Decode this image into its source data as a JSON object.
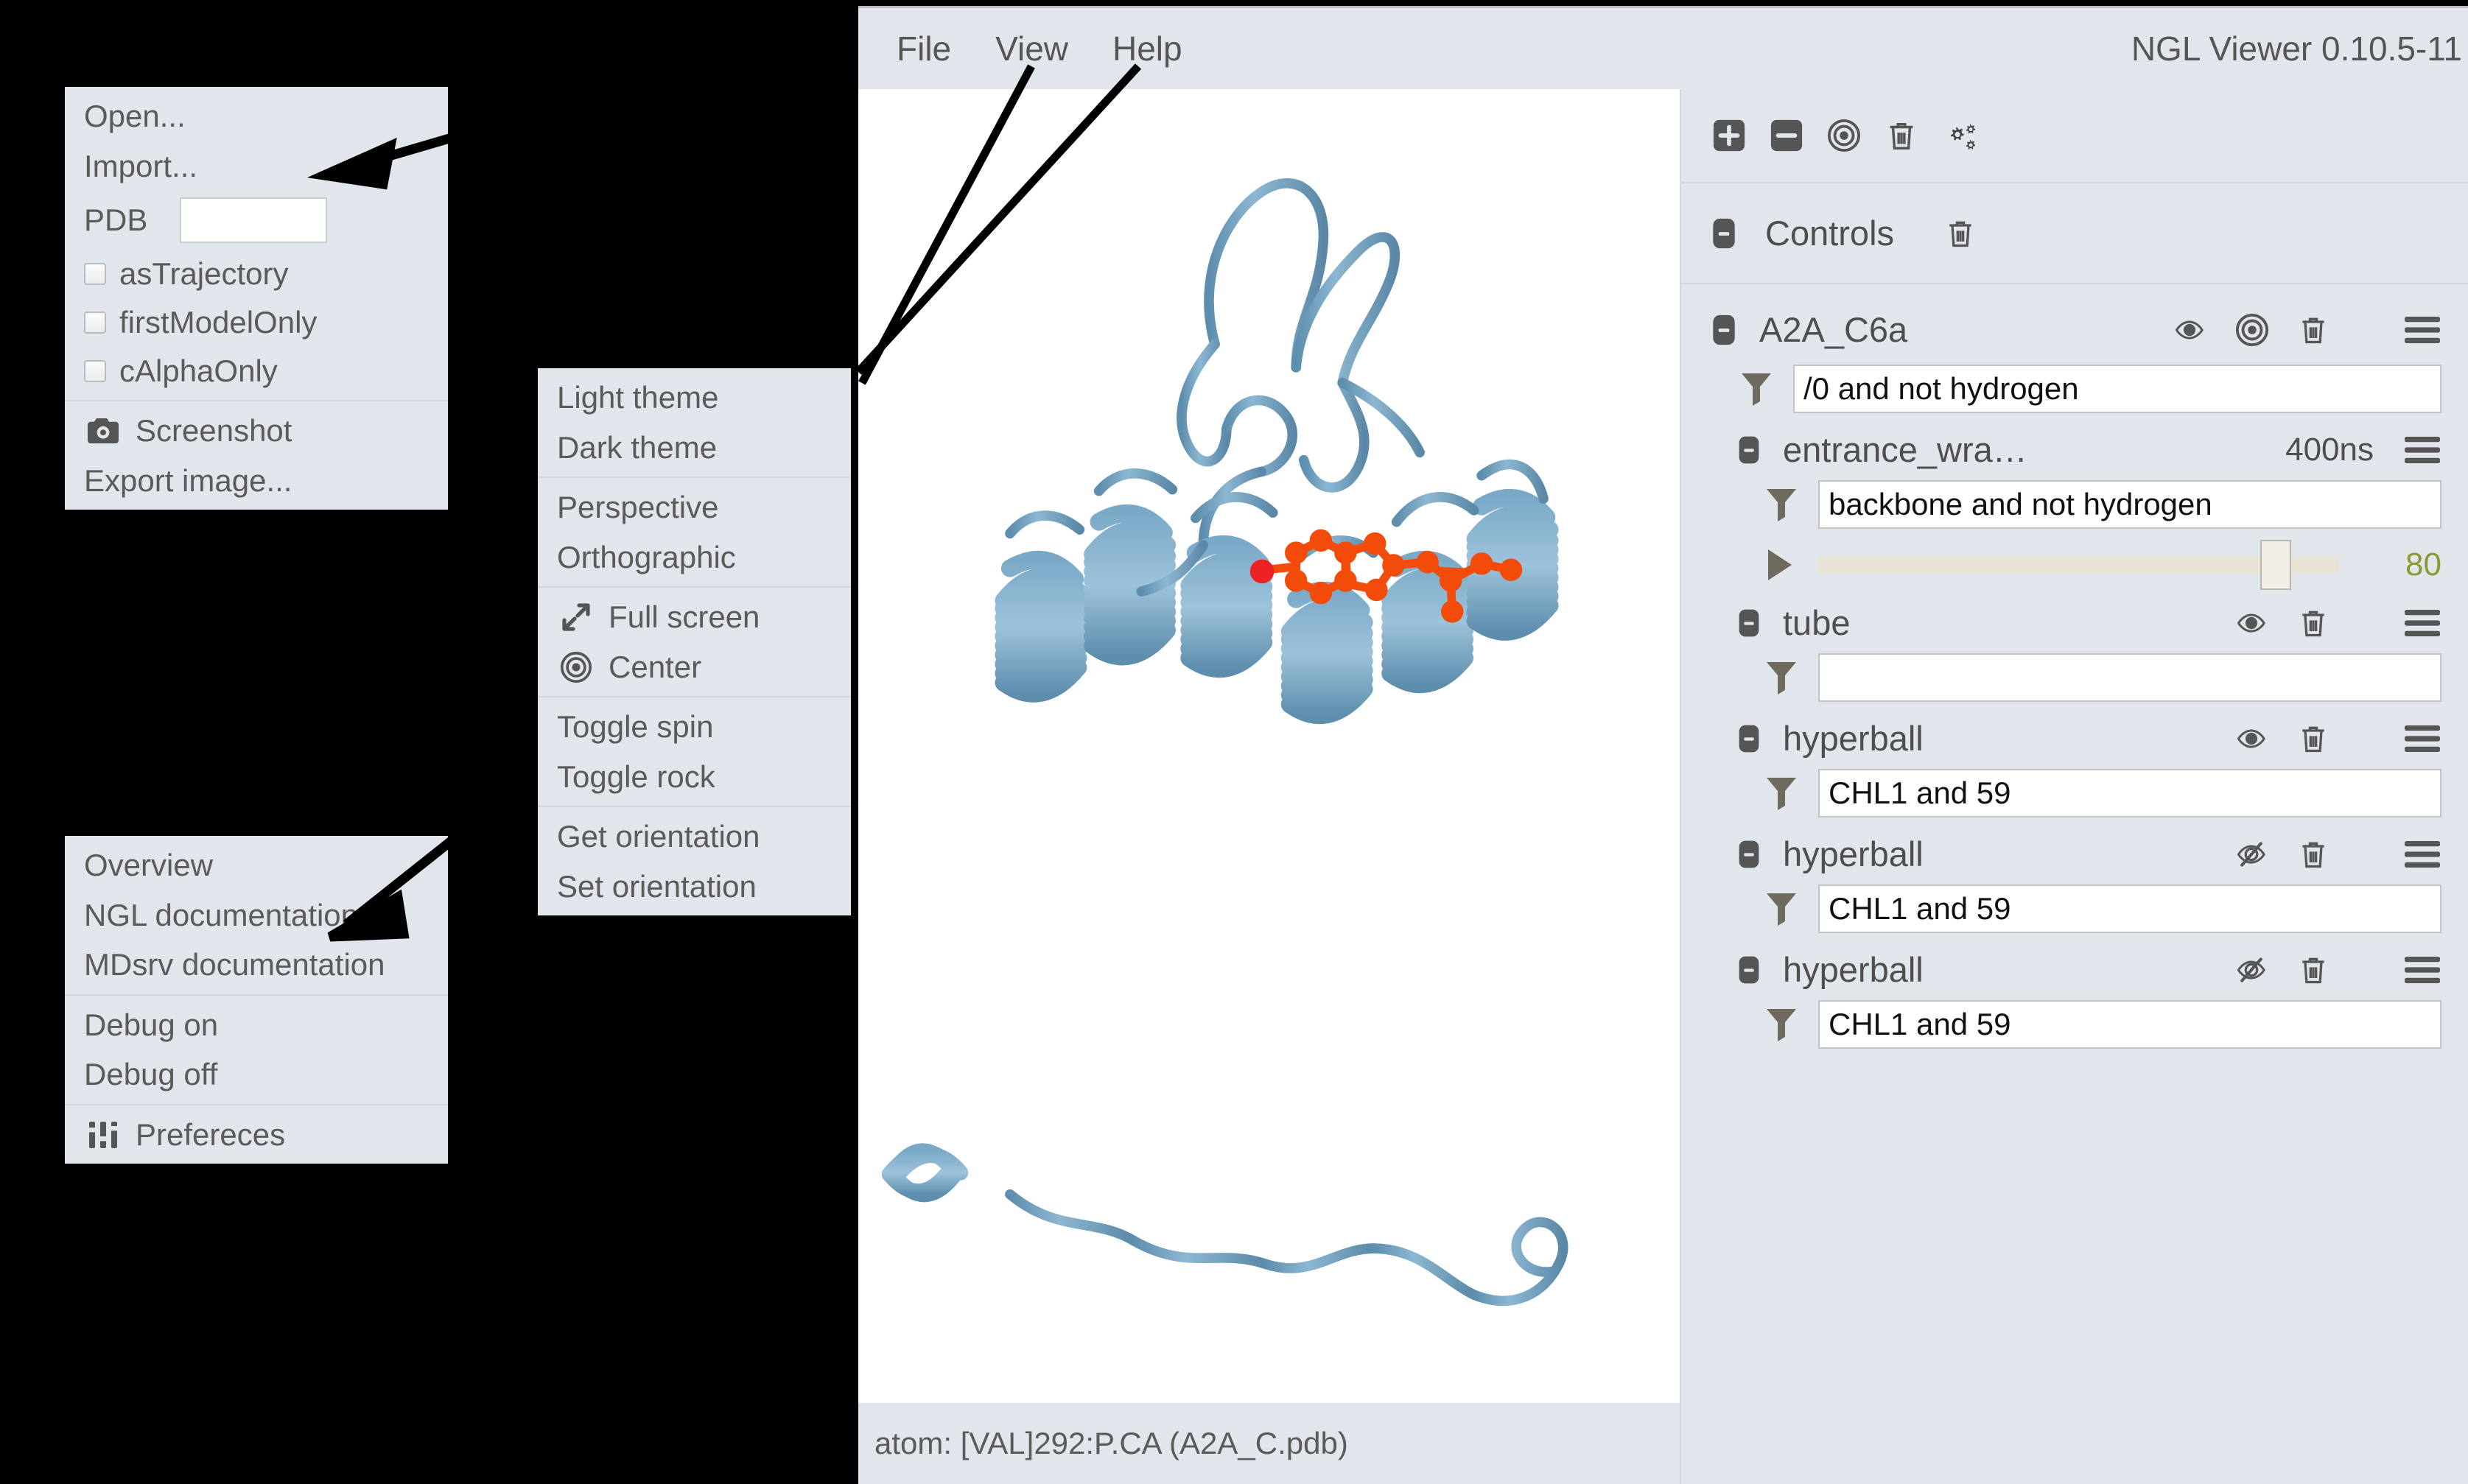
{
  "app": {
    "title": "NGL Viewer 0.10.5-11",
    "menubar": [
      {
        "label": "File",
        "name": "menubar-file"
      },
      {
        "label": "View",
        "name": "menubar-view"
      },
      {
        "label": "Help",
        "name": "menubar-help"
      }
    ],
    "statusbar": "atom: [VAL]292:P.CA (A2A_C.pdb)"
  },
  "file_menu": {
    "open": "Open...",
    "import": "Import...",
    "pdb_label": "PDB",
    "pdb_value": "",
    "checkboxes": [
      {
        "label": "asTrajectory",
        "checked": false
      },
      {
        "label": "firstModelOnly",
        "checked": false
      },
      {
        "label": "cAlphaOnly",
        "checked": false
      }
    ],
    "screenshot": "Screenshot",
    "export_image": "Export image..."
  },
  "view_menu": {
    "groups": [
      {
        "items": [
          {
            "label": "Light theme"
          },
          {
            "label": "Dark theme"
          }
        ]
      },
      {
        "items": [
          {
            "label": "Perspective"
          },
          {
            "label": "Orthographic"
          }
        ]
      },
      {
        "items": [
          {
            "label": "Full screen",
            "icon": "expand-icon"
          },
          {
            "label": "Center",
            "icon": "center-icon"
          }
        ]
      },
      {
        "items": [
          {
            "label": "Toggle spin"
          },
          {
            "label": "Toggle rock"
          }
        ]
      },
      {
        "items": [
          {
            "label": "Get orientation"
          },
          {
            "label": "Set orientation"
          }
        ]
      }
    ]
  },
  "help_menu": {
    "overview": "Overview",
    "ngl_docs": "NGL documentation",
    "mdsrv_docs": "MDsrv documentation",
    "debug_on": "Debug on",
    "debug_off": "Debug off",
    "preferences": "Prefereces"
  },
  "sidebar": {
    "toolbar": [
      {
        "name": "expand-all-icon"
      },
      {
        "name": "collapse-all-icon"
      },
      {
        "name": "center-icon"
      },
      {
        "name": "trash-icon"
      },
      {
        "name": "gears-icon"
      }
    ],
    "controls_label": "Controls",
    "components": [
      {
        "name": "A2A_C6a",
        "expanded": true,
        "visible": true,
        "has_center": true,
        "has_menu": true,
        "selection": "/0 and not hydrogen",
        "reprs": [
          {
            "name": "entrance_wra…",
            "frames": "400ns",
            "selection": "backbone and not hydrogen",
            "has_slider": true,
            "slider_value": "80",
            "slider_percent": 85,
            "has_menu": true
          },
          {
            "name": "tube",
            "visible": true,
            "selection": "",
            "has_menu": true
          },
          {
            "name": "hyperball",
            "visible": true,
            "selection": "CHL1 and 59",
            "has_menu": true
          },
          {
            "name": "hyperball",
            "visible": false,
            "selection": "CHL1 and 59",
            "has_menu": true
          },
          {
            "name": "hyperball",
            "visible": false,
            "selection": "CHL1 and 59",
            "has_menu": true
          }
        ]
      }
    ]
  },
  "colors": {
    "panel_bg": "#e1e5ec",
    "text": "#555555",
    "protein": "#6f9fc0",
    "ligand": "#f24b0a",
    "slider_value": "#8a9a30",
    "viewport_bg": "#ffffff"
  }
}
